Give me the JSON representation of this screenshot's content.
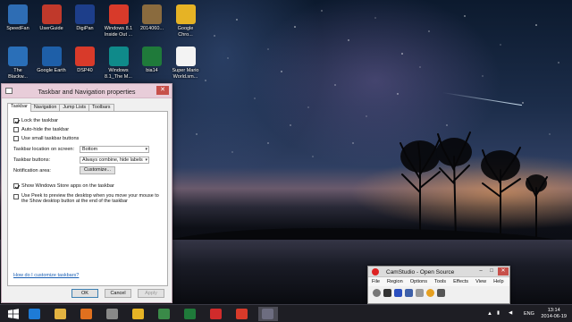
{
  "desktop": {
    "icons_row1": [
      {
        "label": "SpeedFan",
        "icon": "speedfan-icon",
        "color": "#2e6db4"
      },
      {
        "label": "UserGuide",
        "icon": "userguide-icon",
        "color": "#c0392b"
      },
      {
        "label": "DigiPan",
        "icon": "digipan-icon",
        "color": "#1d3e8a"
      },
      {
        "label": "Windows 8.1\nInside Out ...",
        "icon": "pdf-icon",
        "color": "#d83a2a"
      },
      {
        "label": "2014060...",
        "icon": "folder-photos-icon",
        "color": "#8a6b3e"
      },
      {
        "label": "Google\nChro...",
        "icon": "chrome-icon",
        "color": "#e6b325"
      }
    ],
    "icons_row2": [
      {
        "label": "The\nBlackw...",
        "icon": "blackwidow-icon",
        "color": "#2a6fb8"
      },
      {
        "label": "Google Earth",
        "icon": "google-earth-icon",
        "color": "#1e5fa8"
      },
      {
        "label": "DSP40",
        "icon": "pdf-icon",
        "color": "#d83a2a"
      },
      {
        "label": "Windows\n8.1_The M...",
        "icon": "windows-app-icon",
        "color": "#0f8a8a"
      },
      {
        "label": "bia14",
        "icon": "excel-icon",
        "color": "#1f7a3a"
      },
      {
        "label": "Super Mario\nWorld.sm...",
        "icon": "document-icon",
        "color": "#f3f3f3"
      }
    ]
  },
  "dialog": {
    "title": "Taskbar and Navigation properties",
    "close": "✕",
    "tabs": [
      "Taskbar",
      "Navigation",
      "Jump Lists",
      "Toolbars"
    ],
    "options": {
      "lock": {
        "label": "Lock the taskbar",
        "checked": true
      },
      "autohide": {
        "label": "Auto-hide the taskbar",
        "checked": false
      },
      "small": {
        "label": "Use small taskbar buttons",
        "checked": false
      }
    },
    "location_label": "Taskbar location on screen:",
    "location_value": "Bottom",
    "buttons_label": "Taskbar buttons:",
    "buttons_value": "Always combine, hide labels",
    "notification_label": "Notification area:",
    "customize_label": "Customize...",
    "store_apps": {
      "label": "Show Windows Store apps on the taskbar",
      "checked": true
    },
    "peek": {
      "label": "Use Peek to preview the desktop when you move your mouse to the Show desktop button at the end of the taskbar",
      "checked": false
    },
    "help_link": "How do I customize taskbars?",
    "ok": "OK",
    "cancel": "Cancel",
    "apply": "Apply"
  },
  "camstudio": {
    "title": "CamStudio - Open Source",
    "menu": [
      "File",
      "Region",
      "Options",
      "Tools",
      "Effects",
      "View",
      "Help"
    ]
  },
  "taskbar": {
    "apps": [
      "ie-icon",
      "explorer-icon",
      "firefox-icon",
      "camstudio-icon",
      "chrome-icon",
      "app-icon",
      "excel-icon",
      "red-app-icon",
      "pdf-icon",
      "active-window-icon"
    ],
    "language": "ENG",
    "time": "13:14",
    "date": "2014-06-19"
  }
}
